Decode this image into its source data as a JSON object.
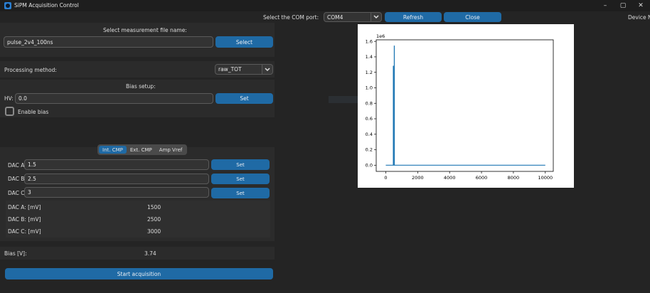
{
  "window": {
    "title": "SiPM Acquisition Control",
    "controls": [
      "–",
      "▢",
      "✕"
    ]
  },
  "com_bar": {
    "label": "Select the COM port:",
    "port_value": "COM4",
    "refresh_label": "Refresh",
    "close_label": "Close",
    "device_label": "Device N"
  },
  "file": {
    "heading": "Select measurement file name:",
    "value": "pulse_2v4_100ns",
    "select_label": "Select"
  },
  "processing": {
    "label": "Processing method:",
    "value": "raw_TOT"
  },
  "bias": {
    "heading": "Bias setup:",
    "hv_label": "HV:",
    "hv_value": "0.0",
    "set_label": "Set",
    "enable_label": "Enable bias"
  },
  "tabs": [
    {
      "label": "Int. CMP",
      "active": true
    },
    {
      "label": "Ext. CMP",
      "active": false
    },
    {
      "label": "Amp Vref",
      "active": false
    }
  ],
  "dac_inputs": [
    {
      "label": "DAC A",
      "value": "1.5",
      "button": "Set"
    },
    {
      "label": "DAC B",
      "value": "2.5",
      "button": "Set"
    },
    {
      "label": "DAC C",
      "value": "3",
      "button": "Set"
    }
  ],
  "dac_readouts": [
    {
      "label": "DAC A: [mV]",
      "value": "1500"
    },
    {
      "label": "DAC B: [mV]",
      "value": "2500"
    },
    {
      "label": "DAC C: [mV]",
      "value": "3000"
    }
  ],
  "bias_readout": {
    "label": "Bias [V]:",
    "value": "3.74"
  },
  "start_label": "Start acquisition",
  "colors": {
    "accent": "#1f6aa5",
    "background": "#242424",
    "panel": "#2b2b2b",
    "plot_line": "#1f77b4"
  },
  "chart_data": {
    "type": "line",
    "title": "",
    "xlabel": "",
    "ylabel": "",
    "y_scale_label": "1e6",
    "xlim": [
      -600,
      10500
    ],
    "ylim": [
      -0.08,
      1.62
    ],
    "x_ticks": [
      0,
      2000,
      4000,
      6000,
      8000,
      10000
    ],
    "x_tick_labels": [
      "0",
      "2000",
      "4000",
      "6000",
      "8000",
      "10000"
    ],
    "y_ticks": [
      0.0,
      0.2,
      0.4,
      0.6,
      0.8,
      1.0,
      1.2,
      1.4,
      1.6
    ],
    "y_tick_labels": [
      "0.0",
      "0.2",
      "0.4",
      "0.6",
      "0.8",
      "1.0",
      "1.2",
      "1.4",
      "1.6"
    ],
    "grid": false,
    "series": [
      {
        "x": [
          0,
          470,
          470,
          480,
          480,
          530,
          530,
          540,
          540,
          10000
        ],
        "y": [
          0,
          0,
          1.28,
          1.28,
          0,
          0,
          1.54,
          1.54,
          0,
          0
        ]
      }
    ]
  }
}
